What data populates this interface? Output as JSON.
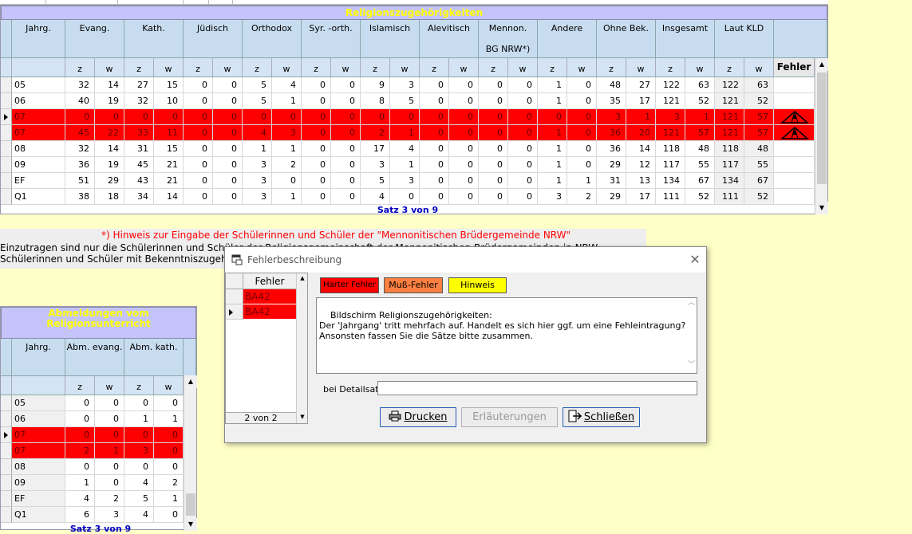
{
  "main": {
    "title": "Religionszugehörigkeiten",
    "headers": [
      "Jahrg.",
      "Evang.",
      "Kath.",
      "Jüdisch",
      "Orthodox",
      "Syr. -orth.",
      "Islamisch",
      "Alevitisch",
      "Mennon.",
      "Andere",
      "Ohne Bek.",
      "Insgesamt",
      "Laut KLD"
    ],
    "header_line2_mennon": "BG NRW*)",
    "sub": [
      "z",
      "w"
    ],
    "fehler_header": "Fehler",
    "rows": [
      {
        "state": "norm",
        "cells": [
          "05",
          "32",
          "14",
          "27",
          "15",
          "0",
          "0",
          "5",
          "4",
          "0",
          "0",
          "9",
          "3",
          "0",
          "0",
          "0",
          "0",
          "1",
          "0",
          "48",
          "27",
          "122",
          "63",
          "122",
          "63"
        ]
      },
      {
        "state": "norm",
        "cells": [
          "06",
          "40",
          "19",
          "32",
          "10",
          "0",
          "0",
          "5",
          "1",
          "0",
          "0",
          "8",
          "5",
          "0",
          "0",
          "0",
          "0",
          "1",
          "0",
          "35",
          "17",
          "121",
          "52",
          "121",
          "52"
        ]
      },
      {
        "state": "err",
        "cells": [
          "07",
          "0",
          "0",
          "0",
          "0",
          "0",
          "0",
          "0",
          "0",
          "0",
          "0",
          "0",
          "0",
          "0",
          "0",
          "0",
          "0",
          "0",
          "0",
          "3",
          "1",
          "3",
          "1",
          "121",
          "57"
        ]
      },
      {
        "state": "err",
        "cells": [
          "07",
          "45",
          "22",
          "33",
          "11",
          "0",
          "0",
          "4",
          "3",
          "0",
          "0",
          "2",
          "1",
          "0",
          "0",
          "0",
          "0",
          "1",
          "0",
          "36",
          "20",
          "121",
          "57",
          "121",
          "57"
        ]
      },
      {
        "state": "norm",
        "cells": [
          "08",
          "32",
          "14",
          "31",
          "15",
          "0",
          "0",
          "1",
          "1",
          "0",
          "0",
          "17",
          "4",
          "0",
          "0",
          "0",
          "0",
          "1",
          "0",
          "36",
          "14",
          "118",
          "48",
          "118",
          "48"
        ]
      },
      {
        "state": "norm",
        "cells": [
          "09",
          "36",
          "19",
          "45",
          "21",
          "0",
          "0",
          "3",
          "2",
          "0",
          "0",
          "3",
          "1",
          "0",
          "0",
          "0",
          "0",
          "1",
          "0",
          "29",
          "12",
          "117",
          "55",
          "117",
          "55"
        ]
      },
      {
        "state": "norm",
        "cells": [
          "EF",
          "51",
          "29",
          "43",
          "21",
          "0",
          "0",
          "3",
          "0",
          "0",
          "0",
          "5",
          "3",
          "0",
          "0",
          "0",
          "0",
          "1",
          "1",
          "31",
          "13",
          "134",
          "67",
          "134",
          "67"
        ]
      },
      {
        "state": "norm",
        "cells": [
          "Q1",
          "38",
          "18",
          "34",
          "14",
          "0",
          "0",
          "3",
          "1",
          "0",
          "0",
          "4",
          "0",
          "0",
          "0",
          "0",
          "0",
          "3",
          "2",
          "29",
          "17",
          "111",
          "52",
          "111",
          "52"
        ]
      }
    ],
    "status": "Satz 3 von 9"
  },
  "hint": {
    "title": "*) Hinweis zur Eingabe der Schülerinnen und Schüler der \"Mennonitischen Brüdergemeinde NRW\"",
    "line1": "Einzutragen sind nur die Schülerinnen und Schüler der Religionsgemeinschaft der Mennonitischen Brüdergemeinden in NRW",
    "line2": "Schülerinnen und Schüler mit Bekenntniszugehör"
  },
  "abm": {
    "title_line1": "Abmeldungen vom",
    "title_line2": "Religionsunterricht",
    "headers": [
      "Jahrg.",
      "Abm. evang.",
      "Abm. kath."
    ],
    "sub": [
      "z",
      "w"
    ],
    "rows": [
      {
        "state": "norm",
        "cells": [
          "05",
          "0",
          "0",
          "0",
          "0"
        ]
      },
      {
        "state": "norm",
        "cells": [
          "06",
          "0",
          "0",
          "1",
          "1"
        ]
      },
      {
        "state": "err",
        "cells": [
          "07",
          "0",
          "0",
          "0",
          "0"
        ]
      },
      {
        "state": "err",
        "cells": [
          "07",
          "2",
          "1",
          "3",
          "0"
        ]
      },
      {
        "state": "norm",
        "cells": [
          "08",
          "0",
          "0",
          "0",
          "0"
        ]
      },
      {
        "state": "norm",
        "cells": [
          "09",
          "1",
          "0",
          "4",
          "2"
        ]
      },
      {
        "state": "norm",
        "cells": [
          "EF",
          "4",
          "2",
          "5",
          "1"
        ]
      },
      {
        "state": "norm",
        "cells": [
          "Q1",
          "6",
          "3",
          "4",
          "0"
        ]
      }
    ],
    "status": "Satz 3 von 9"
  },
  "dialog": {
    "title": "Fehlerbeschreibung",
    "list_header": "Fehler",
    "list_items": [
      "BA42",
      "BA42"
    ],
    "list_status": "2 von 2",
    "legend": {
      "harter": "Harter Fehler",
      "muss": "Muß-Fehler",
      "hinweis": "Hinweis"
    },
    "description": "Bildschirm Religionszugehörigkeiten:\nDer 'Jahrgang' tritt mehrfach auf. Handelt es sich hier ggf. um eine Fehleintragung? Ansonsten fassen Sie die Sätze bitte zusammen.",
    "detail_label": "bei Detailsatz:",
    "detail_value": "",
    "buttons": {
      "drucken": "Drucken",
      "erlaeuterungen": "Erläuterungen",
      "schliessen": "Schließen"
    }
  },
  "colors": {
    "error_red": "#ff0000",
    "muss_orange": "#ff8040",
    "hinweis_yellow": "#ffff00",
    "title_purple": "#c4c4fb",
    "title_text": "#ffff00",
    "status_blue": "#0000c0"
  }
}
